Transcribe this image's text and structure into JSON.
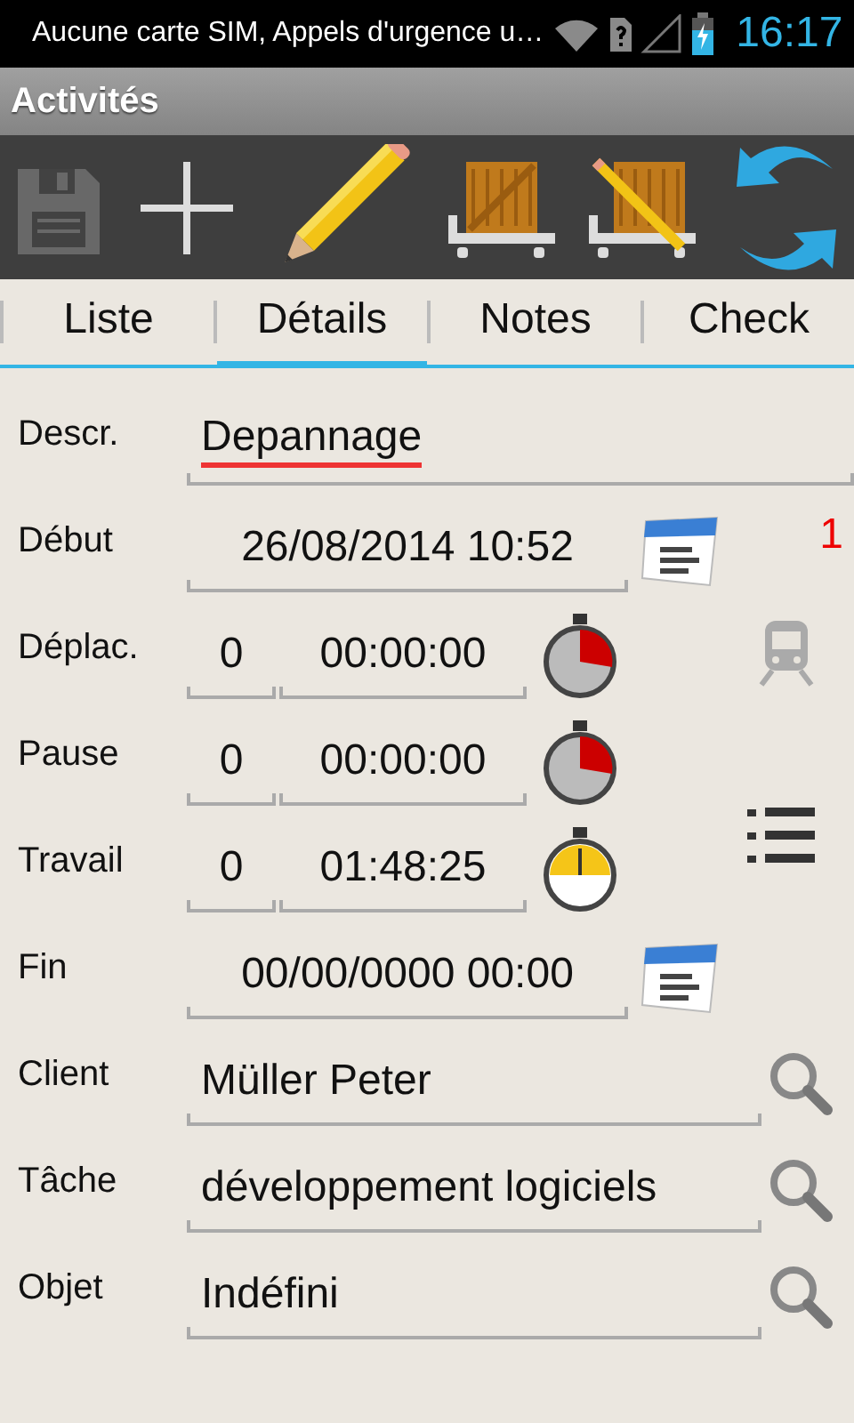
{
  "status_bar": {
    "notification": "Aucune carte SIM, Appels d'urgence u…",
    "time": "16:17"
  },
  "title": "Activités",
  "toolbar": [
    {
      "kind": "save",
      "disabled": true
    },
    {
      "kind": "add",
      "disabled": false
    },
    {
      "kind": "edit",
      "disabled": false
    },
    {
      "kind": "cart",
      "disabled": false
    },
    {
      "kind": "cart_edit",
      "disabled": false
    },
    {
      "kind": "sync",
      "disabled": false
    }
  ],
  "tabs": [
    {
      "label": "Liste",
      "selected": false
    },
    {
      "label": "Détails",
      "selected": true
    },
    {
      "label": "Notes",
      "selected": false
    },
    {
      "label": "Check",
      "selected": false
    }
  ],
  "fields": [
    {
      "kind": "text",
      "label": "Descr.",
      "value": "Depannage",
      "misspelled": true
    },
    {
      "kind": "datetime",
      "label": "Début",
      "value": "26/08/2014 10:52",
      "badge": "1"
    },
    {
      "kind": "timer",
      "label": "Déplac.",
      "count": "0",
      "duration": "00:00:00",
      "running": false,
      "side": {
        "kind": "train"
      }
    },
    {
      "kind": "timer",
      "label": "Pause",
      "count": "0",
      "duration": "00:00:00",
      "running": false
    },
    {
      "kind": "timer",
      "label": "Travail",
      "count": "0",
      "duration": "01:48:25",
      "running": true,
      "side": {
        "kind": "list"
      }
    },
    {
      "kind": "datetime",
      "label": "Fin",
      "value": "00/00/0000 00:00"
    },
    {
      "kind": "lookup",
      "label": "Client",
      "value": "Müller Peter"
    },
    {
      "kind": "lookup",
      "label": "Tâche",
      "value": "développement logiciels"
    },
    {
      "kind": "lookup",
      "label": "Objet",
      "value": "Indéfini"
    }
  ]
}
